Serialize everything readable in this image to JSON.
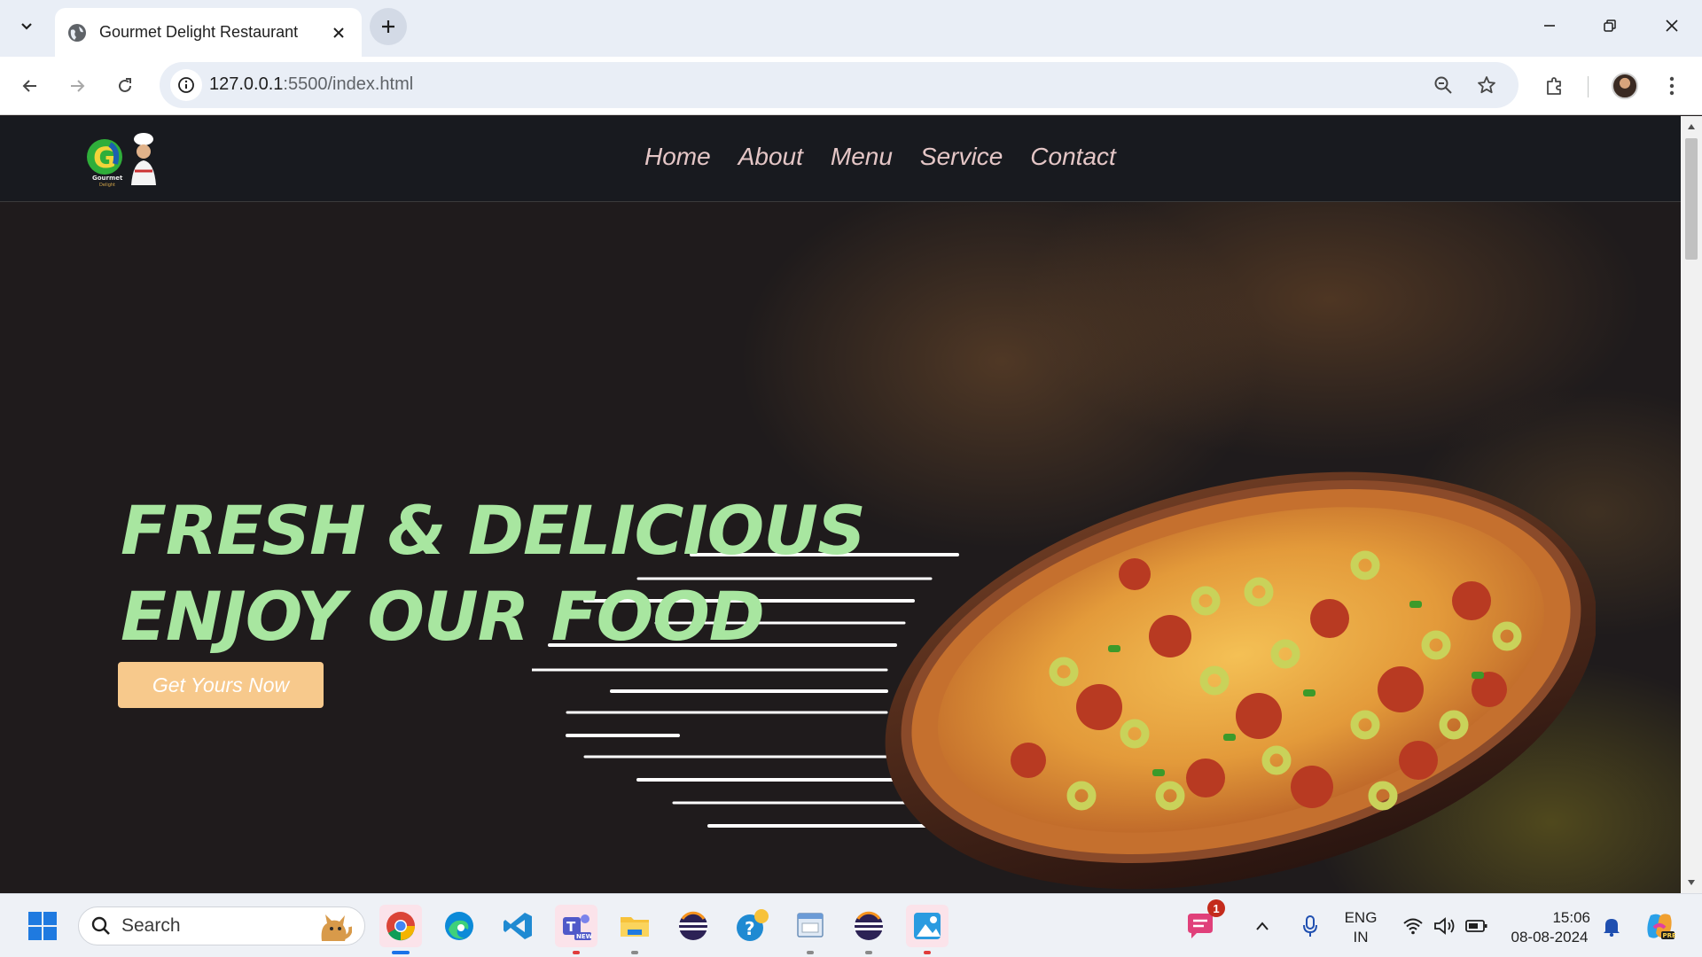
{
  "browser": {
    "tab": {
      "title": "Gourmet Delight Restaurant",
      "favicon": "globe-icon"
    },
    "url": {
      "host": "127.0.0.1",
      "path": ":5500/index.html"
    },
    "window_controls": [
      "minimize-icon",
      "restore-icon",
      "close-icon"
    ]
  },
  "site": {
    "logo": {
      "brand_text": "Gourmet",
      "brand_sub": "Delight"
    },
    "nav": [
      {
        "label": "Home"
      },
      {
        "label": "About"
      },
      {
        "label": "Menu"
      },
      {
        "label": "Service"
      },
      {
        "label": "Contact"
      }
    ],
    "hero": {
      "title_line1": "FRESH & DELICIOUS",
      "title_line2": "ENJOY OUR FOOD",
      "cta_label": "Get Yours Now"
    },
    "colors": {
      "nav_bg": "#181a1f",
      "nav_link": "#e4c6c6",
      "hero_bg": "#1f1b1c",
      "hero_title": "#a8e6a0",
      "cta_bg": "#f7c98c"
    }
  },
  "taskbar": {
    "search_label": "Search",
    "apps": [
      "windows-start-icon",
      "chrome-icon",
      "edge-icon",
      "vscode-icon",
      "teams-icon",
      "file-explorer-icon",
      "eclipse-icon",
      "help-icon",
      "control-panel-icon",
      "eclipse-icon",
      "photos-icon"
    ],
    "notification_count": "1",
    "language_line1": "ENG",
    "language_line2": "IN",
    "time": "15:06",
    "date": "08-08-2024"
  }
}
